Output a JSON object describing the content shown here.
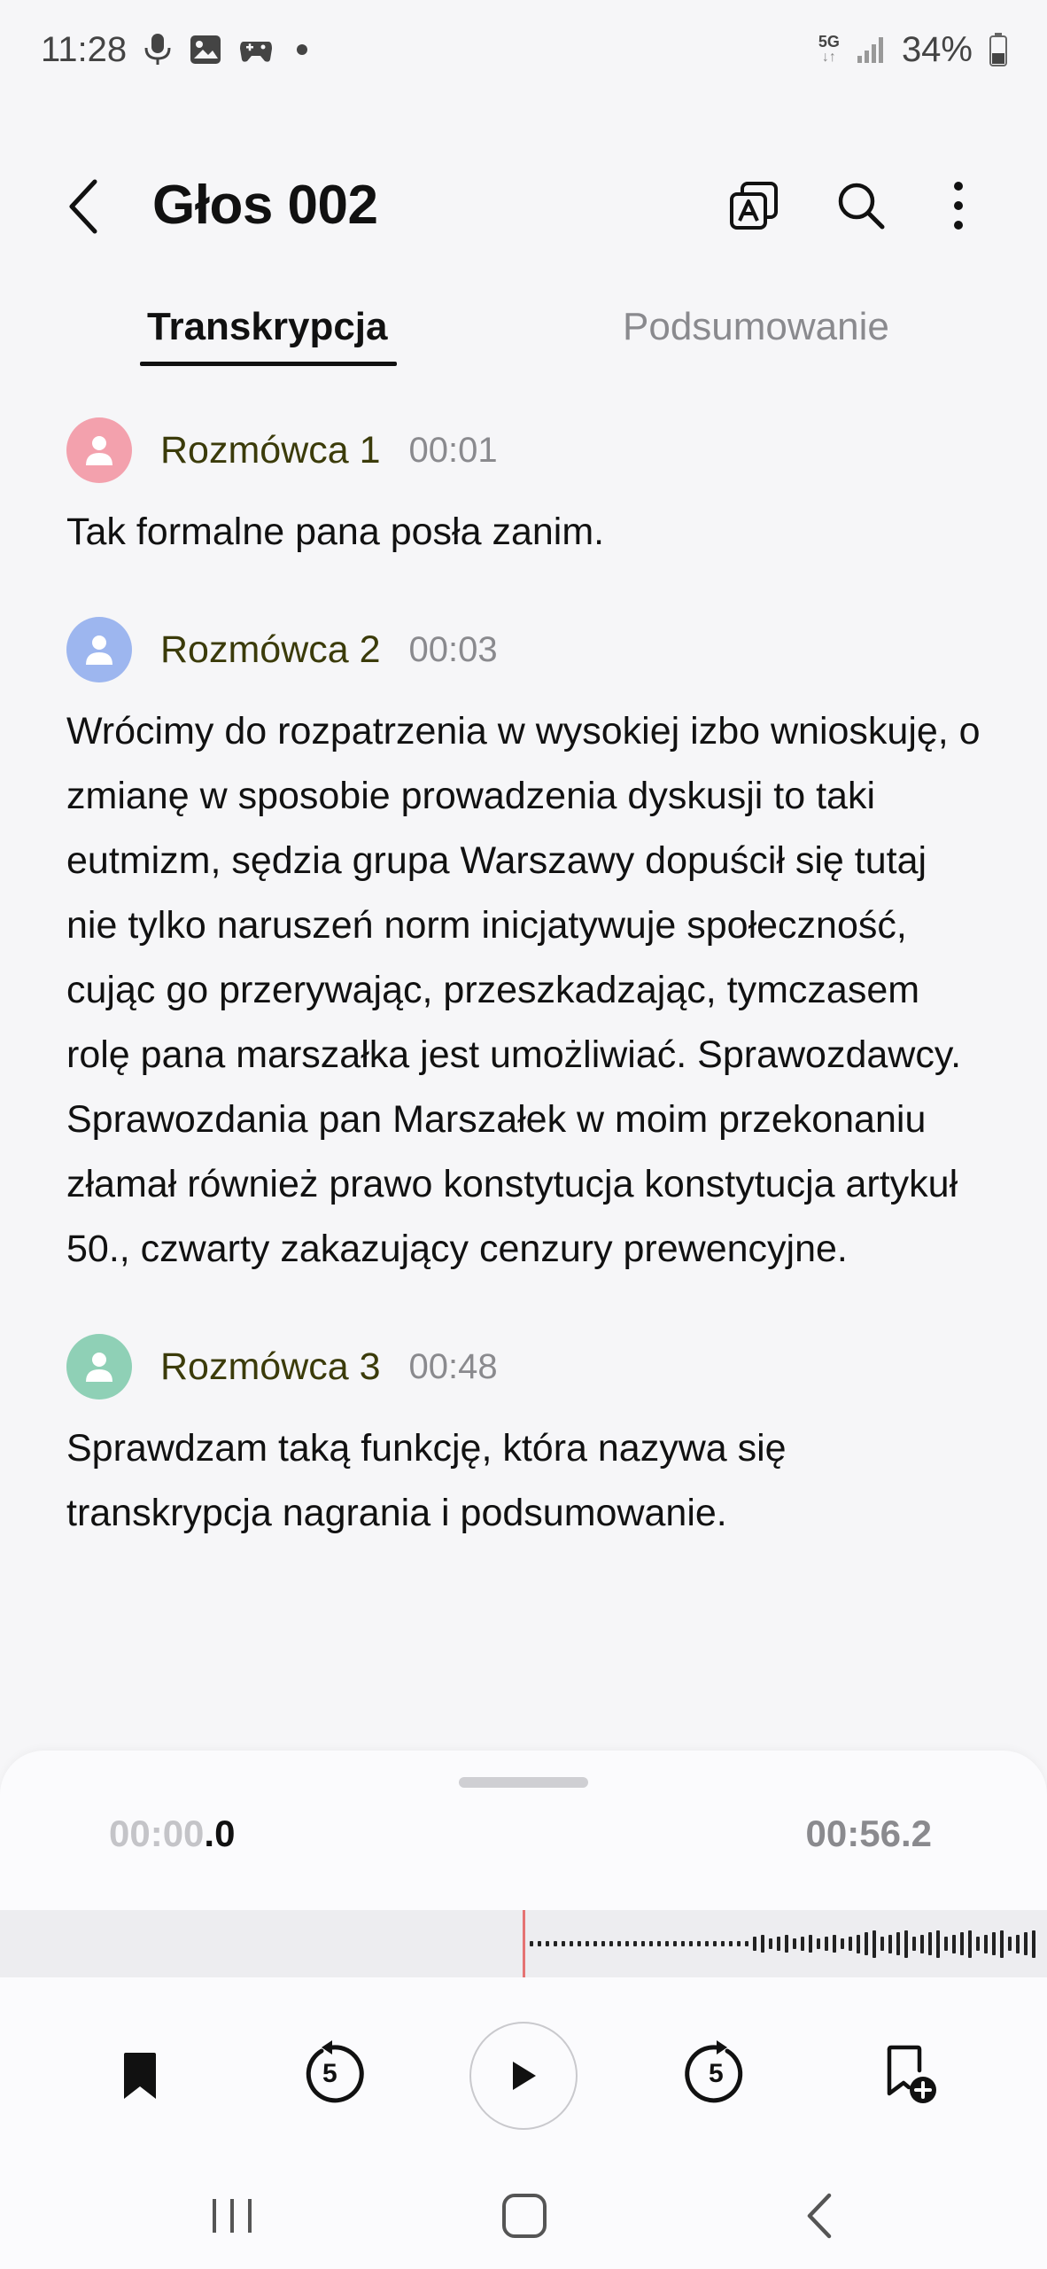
{
  "status_bar": {
    "time": "11:28",
    "network": "5G",
    "battery": "34%",
    "icons": [
      "mic-icon",
      "image-icon",
      "gamepad-icon"
    ]
  },
  "app_bar": {
    "title": "Głos 002",
    "actions": [
      "translate-icon",
      "search-icon",
      "more-icon"
    ]
  },
  "tabs": {
    "items": [
      {
        "label": "Transkrypcja",
        "active": true
      },
      {
        "label": "Podsumowanie",
        "active": false
      }
    ]
  },
  "transcript": [
    {
      "speaker": "Rozmówca 1",
      "time": "00:01",
      "avatar_color": "#f3a1ad",
      "text": "Tak formalne pana posła zanim."
    },
    {
      "speaker": "Rozmówca 2",
      "time": "00:03",
      "avatar_color": "#9db6ef",
      "text": "Wrócimy do rozpatrzenia w wysokiej izbo wnioskuję, o zmianę w sposobie prowadzenia dyskusji to taki eutmizm, sędzia grupa Warszawy dopuścił się tutaj nie tylko naruszeń norm inicjatywuje społeczność, cując go przerywając, przeszkadzając, tymczasem rolę pana marszałka jest umożliwiać. Sprawozdawcy. Sprawozdania pan Marszałek w moim przekonaniu złamał również prawo konstytucja konstytucja artykuł 50., czwarty zakazujący cenzury prewencyjne."
    },
    {
      "speaker": "Rozmówca 3",
      "time": "00:48",
      "avatar_color": "#8fd0b6",
      "text": "Sprawdzam taką funkcję, która nazywa się transkrypcja nagrania i podsumowanie."
    }
  ],
  "player": {
    "current_time_main": "00:00",
    "current_time_fraction": ".0",
    "total_time": "00:56.2",
    "progress": 0.0,
    "skip_back_seconds": "5",
    "skip_forward_seconds": "5"
  },
  "colors": {
    "background": "#f6f6f8",
    "speaker_name": "#3b3b0a",
    "muted": "#8a8a8e",
    "playhead": "#e57373"
  }
}
